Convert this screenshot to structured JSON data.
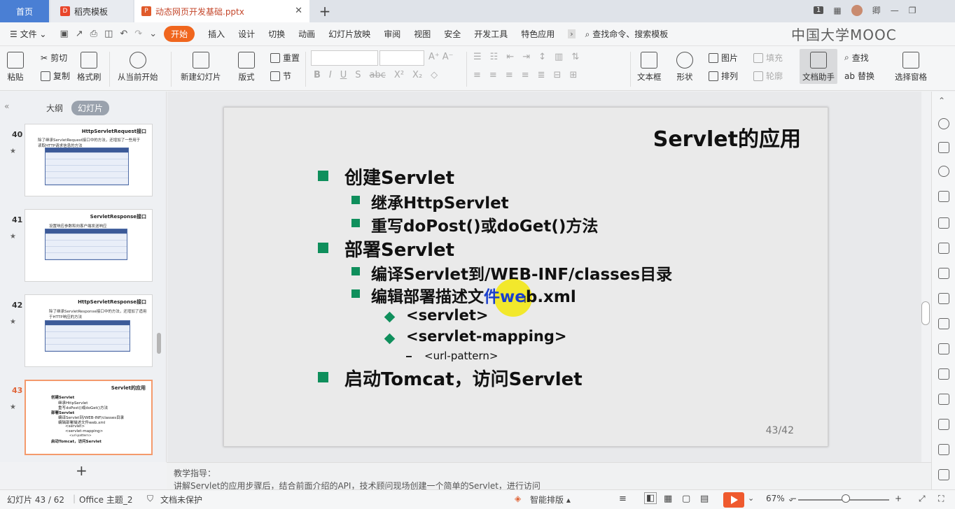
{
  "titlebar": {
    "tabs": [
      {
        "label": "首页"
      },
      {
        "label": "稻壳模板"
      },
      {
        "label": "动态网页开发基础.pptx"
      }
    ],
    "page_badge": "1",
    "user": "卿",
    "watermark": "中国大学MOOC"
  },
  "menu": {
    "file": "文件",
    "items": [
      "开始",
      "插入",
      "设计",
      "切换",
      "动画",
      "幻灯片放映",
      "审阅",
      "视图",
      "安全",
      "开发工具",
      "特色应用"
    ],
    "search": "查找命令、搜索模板"
  },
  "ribbon": {
    "paste": "粘贴",
    "cut": "剪切",
    "copy": "复制",
    "format_painter": "格式刷",
    "from_start": "从当前开始",
    "new_slide": "新建幻灯片",
    "layout": "版式",
    "reset": "重置",
    "section": "节",
    "textbox": "文本框",
    "shape": "形状",
    "picture": "图片",
    "arrange": "排列",
    "fill": "填充",
    "outline": "轮廓",
    "doc_helper": "文档助手",
    "find": "查找",
    "replace": "替换",
    "selection_pane": "选择窗格"
  },
  "panel": {
    "outline_tab": "大纲",
    "slides_tab": "幻灯片",
    "thumbs": [
      {
        "num": "40",
        "title": "HttpServletRequest接口",
        "text": "除了继承ServletRequest接口中的方法，还增加了一些用于读取HTTP请求信息的方法"
      },
      {
        "num": "41",
        "title": "ServletResponse接口",
        "text": "设置响应参数和向客户端发送响应"
      },
      {
        "num": "42",
        "title": "HttpServletResponse接口",
        "text": "除了继承ServletResponse接口中的方法，还增加了适用于HTTP响应的方法"
      },
      {
        "num": "43",
        "title": "Servlet的应用"
      }
    ]
  },
  "slide": {
    "title": "Servlet的应用",
    "b1": "创建Servlet",
    "b1a": "继承HttpServlet",
    "b1b": "重写doPost()或doGet()方法",
    "b2": "部署Servlet",
    "b2a": "编译Servlet到/WEB-INF/classes目录",
    "b2b_pre": "编辑部署描述文",
    "b2b_hl": "件we",
    "b2b_post": "b.xml",
    "b2b_i": "<servlet>",
    "b2b_ii": "<servlet-mapping>",
    "b2b_iii": "<url-pattern>",
    "b3": "启动Tomcat，访问Servlet",
    "page": "43/42"
  },
  "notes": {
    "label": "教学指导：",
    "text": "讲解Servlet的应用步骤后，结合前面介绍的API，技术顾问现场创建一个简单的Servlet，进行访问"
  },
  "status": {
    "slide_pos": "幻灯片 43 / 62",
    "theme": "Office 主题_2",
    "protect": "文档未保护",
    "smart": "智能排版",
    "zoom": "67%"
  },
  "colors": {
    "accent": "#f0661e",
    "bullet": "#0f8f5c",
    "highlight": "#f3e80a"
  }
}
